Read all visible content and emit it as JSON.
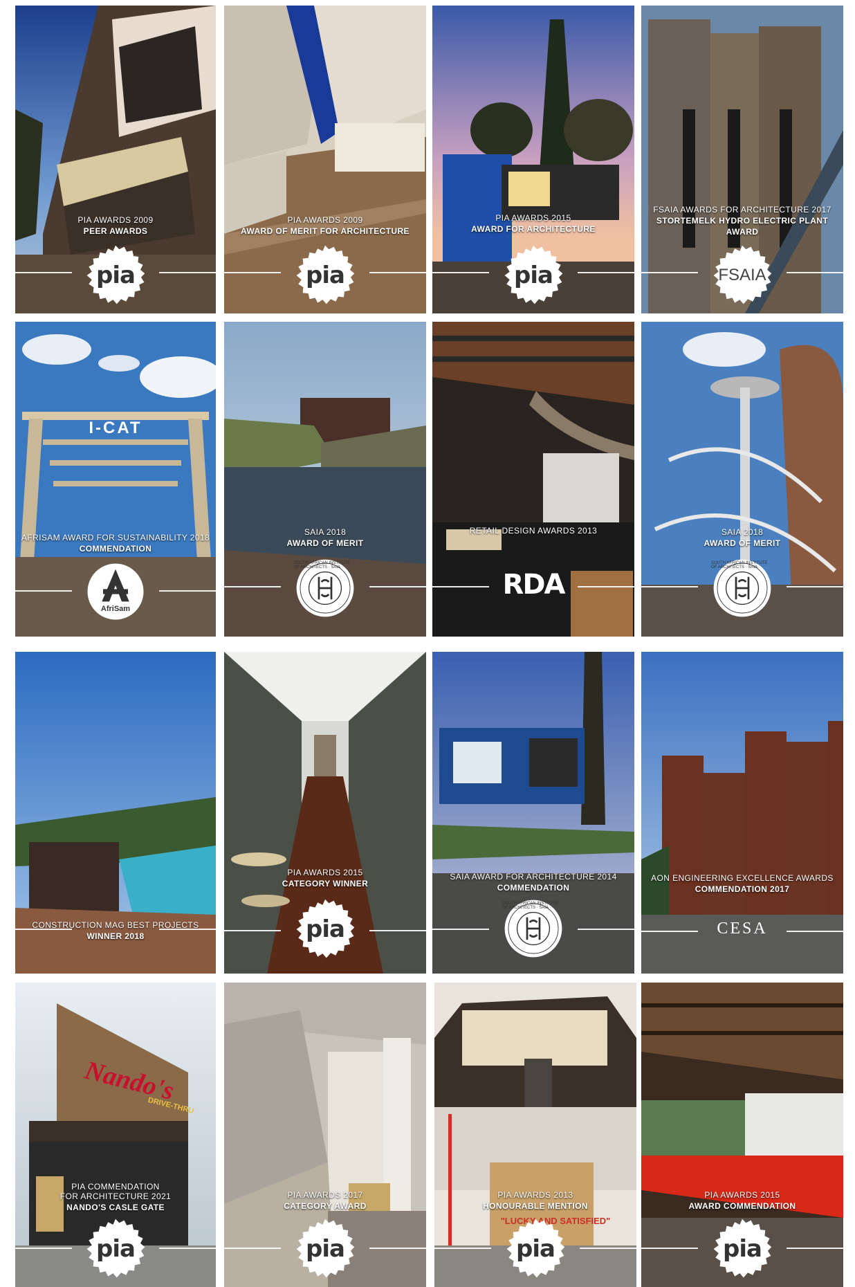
{
  "tiles": [
    {
      "id": "t1",
      "caption": [
        "PIA AWARDS 2009",
        "PEER AWARDS"
      ],
      "logo": "pia"
    },
    {
      "id": "t2",
      "caption": [
        "PIA AWARDS 2009",
        "AWARD OF MERIT FOR ARCHITECTURE"
      ],
      "logo": "pia"
    },
    {
      "id": "t3",
      "caption": [
        "PIA AWARDS 2015",
        "AWARD FOR ARCHITECTURE"
      ],
      "logo": "pia"
    },
    {
      "id": "t4",
      "caption": [
        "FSAIA AWARDS FOR ARCHITECTURE 2017",
        "STORTEMELK HYDRO ELECTRIC PLANT",
        "AWARD"
      ],
      "logo": "fsaia"
    },
    {
      "id": "t5",
      "caption": [
        "AFRISAM AWARD FOR SUSTAINABILITY 2018",
        "COMMENDATION"
      ],
      "logo": "afrisam"
    },
    {
      "id": "t6",
      "caption": [
        "SAIA 2018",
        "AWARD OF MERIT"
      ],
      "logo": "saia"
    },
    {
      "id": "t7",
      "caption": [
        "RETAIL DESIGN AWARDS 2013"
      ],
      "logo": "rda"
    },
    {
      "id": "t8",
      "caption": [
        "SAIA 2018",
        "AWARD OF MERIT"
      ],
      "logo": "saia"
    },
    {
      "id": "t9",
      "caption": [
        "CONSTRUCTION MAG BEST PROJECTS",
        "WINNER 2018"
      ],
      "logo": "none"
    },
    {
      "id": "t10",
      "caption": [
        "PIA AWARDS 2015",
        "CATEGORY WINNER"
      ],
      "logo": "pia"
    },
    {
      "id": "t11",
      "caption": [
        "SAIA AWARD FOR ARCHITECTURE 2014",
        "COMMENDATION"
      ],
      "logo": "saia"
    },
    {
      "id": "t12",
      "caption": [
        "AON ENGINEERING EXCELLENCE AWARDS",
        "COMMENDATION 2017"
      ],
      "logo": "cesa"
    },
    {
      "id": "t13",
      "caption": [
        "PIA COMMENDATION",
        "FOR ARCHITECTURE 2021",
        "NANDO'S CASLE GATE"
      ],
      "logo": "pia"
    },
    {
      "id": "t14",
      "caption": [
        "PIA AWARDS 2017",
        "CATEGORY AWARD"
      ],
      "logo": "pia"
    },
    {
      "id": "t15",
      "caption": [
        "PIA AWARDS 2013",
        "HONOURABLE MENTION"
      ],
      "logo": "pia"
    },
    {
      "id": "t16",
      "caption": [
        "PIA AWARDS 2015",
        "AWARD COMMENDATION"
      ],
      "logo": "pia"
    }
  ],
  "logos": {
    "pia": "pia",
    "fsaia": "FSAIA",
    "afrisam": "AfriSam",
    "saia_ring": "SOUTH AFRICAN INSTITUTE OF ARCHITECTS · SAIA ·",
    "rda": "RDA",
    "cesa": "CESA"
  },
  "signs": {
    "icat": "I-CAT",
    "nandos": "Nando's",
    "nandos_sub": "DRIVE-THRU",
    "lucky": "\"LUCKY AND SATISFIED\""
  },
  "colors": {
    "background": "#ffffff",
    "caption_text": "#ffffff",
    "badge_bg": "#ffffff",
    "nandos_red": "#c8102e"
  }
}
